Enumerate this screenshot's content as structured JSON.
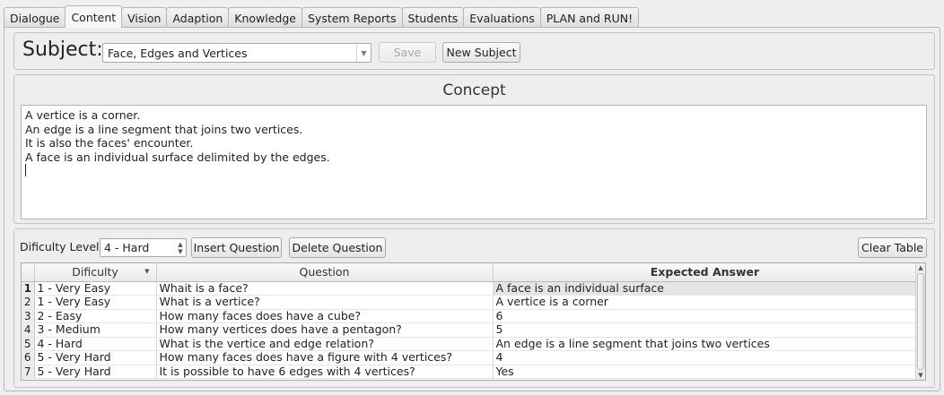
{
  "tabs": [
    {
      "label": "Dialogue",
      "active": false
    },
    {
      "label": "Content",
      "active": true
    },
    {
      "label": "Vision",
      "active": false
    },
    {
      "label": "Adaption",
      "active": false
    },
    {
      "label": "Knowledge",
      "active": false
    },
    {
      "label": "System Reports",
      "active": false
    },
    {
      "label": "Students",
      "active": false
    },
    {
      "label": "Evaluations",
      "active": false
    },
    {
      "label": "PLAN and RUN!",
      "active": false
    }
  ],
  "subject": {
    "label": "Subject:",
    "selected": "Face, Edges and Vertices",
    "save_label": "Save",
    "save_enabled": false,
    "new_label": "New Subject"
  },
  "concept": {
    "title": "Concept",
    "lines": [
      "A vertice is a corner.",
      "An edge is a line segment that joins two vertices.",
      "It is also the faces' encounter.",
      "A face is an individual surface delimited by the edges."
    ]
  },
  "questions": {
    "difficulty_label": "Dificulty Level",
    "difficulty_value": "4 - Hard",
    "insert_label": "Insert Question",
    "delete_label": "Delete Question",
    "clear_label": "Clear Table",
    "columns": [
      "Dificulty",
      "Question",
      "Expected Answer"
    ],
    "selected_row": 1,
    "rows": [
      {
        "num": "1",
        "difficulty": "1 - Very Easy",
        "question": "Whait is a face?",
        "answer": "A face is an individual surface"
      },
      {
        "num": "2",
        "difficulty": "1 - Very Easy",
        "question": "What is a vertice?",
        "answer": "A vertice is a corner"
      },
      {
        "num": "3",
        "difficulty": "2 - Easy",
        "question": "How many faces does have a cube?",
        "answer": "6"
      },
      {
        "num": "4",
        "difficulty": "3 - Medium",
        "question": "How many vertices does have a pentagon?",
        "answer": "5"
      },
      {
        "num": "5",
        "difficulty": "4 - Hard",
        "question": "What is the vertice and edge relation?",
        "answer": "An edge is a line segment that joins two vertices"
      },
      {
        "num": "6",
        "difficulty": "5 - Very Hard",
        "question": "How many faces does have a figure with 4 vertices?",
        "answer": "4"
      },
      {
        "num": "7",
        "difficulty": "5 - Very Hard",
        "question": "It is possible to have 6 edges with 4 vertices?",
        "answer": "Yes"
      }
    ]
  }
}
